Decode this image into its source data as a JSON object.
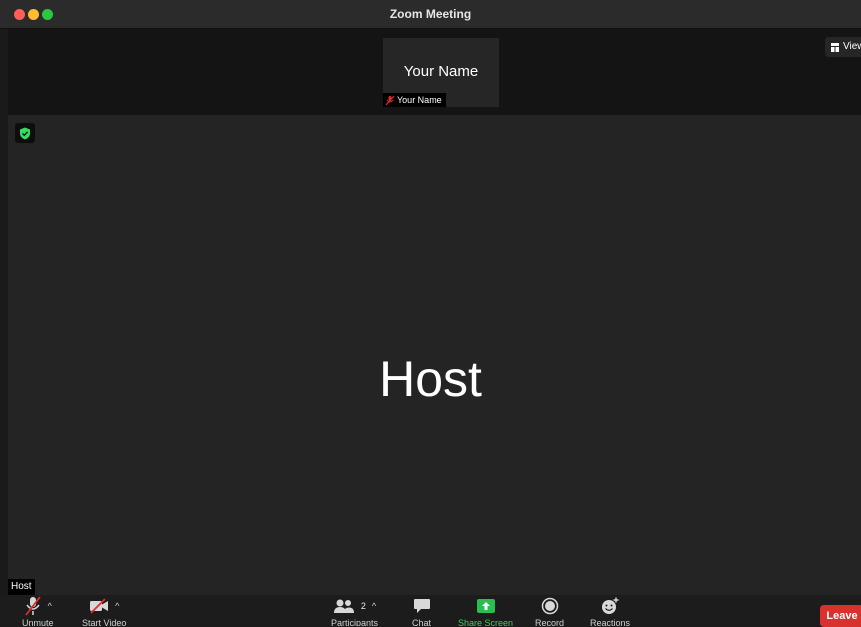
{
  "window": {
    "title": "Zoom Meeting"
  },
  "thumbnail": {
    "display_name": "Your Name",
    "label": "Your Name"
  },
  "view_button": {
    "label": "View"
  },
  "main": {
    "speaker_name": "Host",
    "name_tag": "Host"
  },
  "toolbar": {
    "unmute": {
      "label": "Unmute",
      "icon": "mic-muted-icon"
    },
    "start_video": {
      "label": "Start Video",
      "icon": "video-off-icon"
    },
    "participants": {
      "label": "Participants",
      "count": "2",
      "icon": "people-icon"
    },
    "chat": {
      "label": "Chat",
      "icon": "chat-bubble-icon"
    },
    "share_screen": {
      "label": "Share Screen",
      "icon": "share-arrow-icon"
    },
    "record": {
      "label": "Record",
      "icon": "record-icon"
    },
    "reactions": {
      "label": "Reactions",
      "icon": "emoji-add-icon"
    },
    "leave": {
      "label": "Leave"
    }
  },
  "colors": {
    "leave": "#d9312c",
    "share": "#2bbd4f",
    "muted": "#e02b2b",
    "shield": "#2ee05e"
  }
}
